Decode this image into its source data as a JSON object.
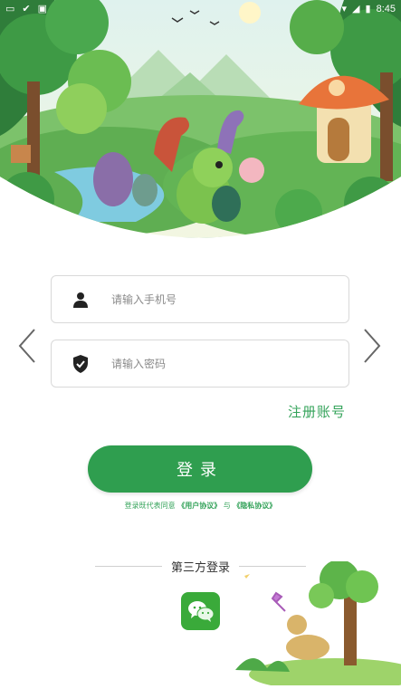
{
  "status_bar": {
    "time": "8:45",
    "left_icons": [
      "notification-icon",
      "check-icon",
      "a-icon"
    ],
    "right_icons": [
      "wifi-icon",
      "signal-icon",
      "battery-icon"
    ]
  },
  "login": {
    "phone_placeholder": "请输入手机号",
    "password_placeholder": "请输入密码",
    "register_label": "注册账号",
    "login_button_label": "登录"
  },
  "agreement": {
    "prefix": "登录既代表同意",
    "user_agreement": "《用户协议》",
    "conjunction": "与",
    "privacy_policy": "《隐私协议》"
  },
  "third_party": {
    "label": "第三方登录",
    "providers": [
      "wechat-icon"
    ]
  },
  "colors": {
    "accent": "#2f9e4f",
    "link": "#34a35a",
    "wechat": "#3aaa3a"
  }
}
